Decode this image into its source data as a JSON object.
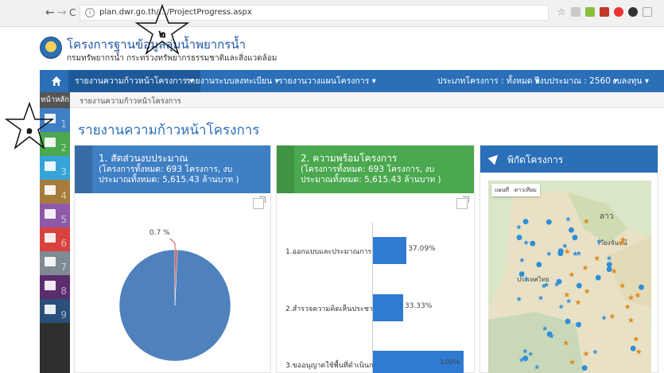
{
  "browser": {
    "url": "plan.dwr.go.th/…/ProjectProgress.aspx",
    "back": "←",
    "forward": "→",
    "reload": "C",
    "info": "i"
  },
  "site": {
    "title": "โครงการฐานข้อมูลลุ่มน้ำพยากรน้ำ",
    "subtitle": "กรมทรัพยากรน้ำ กระทรวงทรัพยากรธรรมชาติและสิ่งแวดล้อม"
  },
  "menu": {
    "items": [
      {
        "label": "รายงานความก้าวหน้าโครงการ ▾",
        "active": true
      },
      {
        "label": "รายงานระบบลงทะเบียน ▾",
        "active": false
      },
      {
        "label": "รายงานวางแผนโครงการ ▾",
        "active": false
      }
    ],
    "right": [
      {
        "label": "ประเภทโครงการ : ทั้งหมด ▾"
      },
      {
        "label": "ปีงบประมาณ : 2560 ▾"
      },
      {
        "label": "งบลงทุน ▾"
      }
    ]
  },
  "breadcrumb": {
    "home": "หน้าหลัก",
    "current": "รายงานความก้าวหน้าโครงการ"
  },
  "sidebar": {
    "items": [
      {
        "num": "1",
        "color": "#3f7fc4"
      },
      {
        "num": "2",
        "color": "#4aa84f"
      },
      {
        "num": "3",
        "color": "#36a3d9"
      },
      {
        "num": "4",
        "color": "#a67c3c"
      },
      {
        "num": "5",
        "color": "#8e5aa8"
      },
      {
        "num": "6",
        "color": "#d7423f"
      },
      {
        "num": "7",
        "color": "#7f8a93"
      },
      {
        "num": "8",
        "color": "#5a2d6e"
      },
      {
        "num": "9",
        "color": "#2a4f7a"
      }
    ]
  },
  "page": {
    "title": "รายงานความก้าวหน้าโครงการ"
  },
  "panels": {
    "budget": {
      "title": "1. สัดส่วนงบประมาณ",
      "desc": "(โครงการทั้งหมด: 693 โครงการ, งบประมาณทั้งหมด: 5,615.43 ล้านบาท )",
      "color": "#3f7fc4",
      "pie_label": "0.7 %"
    },
    "readiness": {
      "title": "2. ความพร้อมโครงการ",
      "desc": "(โครงการทั้งหมด: 693 โครงการ, งบประมาณทั้งหมด: 5,615.43 ล้านบาท )",
      "color": "#4aa84f"
    },
    "map": {
      "title": "พิกัดโครงการ",
      "btn_map": "แผนที่",
      "btn_sat": "ดาวเทียม",
      "labels": [
        "ลาว",
        "เวียงจันทน์",
        "ประเทศไทย"
      ]
    }
  },
  "chart_data": [
    {
      "type": "pie",
      "values": [
        99.3,
        0.7
      ],
      "data_labels": [
        "0.7 %"
      ],
      "colors": [
        "#4f81bd",
        "#c0504d"
      ]
    },
    {
      "type": "bar",
      "orientation": "horizontal",
      "categories": [
        "1.ออกแบบและประมาณการ",
        "2.สำรวจความคิดเห็นประชาชน",
        "3.ขออนุญาตใช้พื้นที่ดำเนินการ"
      ],
      "values": [
        37.09,
        33.33,
        100
      ],
      "data_labels": [
        "37.09%",
        "33.33%",
        "100%"
      ]
    }
  ],
  "annotations": {
    "star1": "๑",
    "star2": "๒"
  }
}
